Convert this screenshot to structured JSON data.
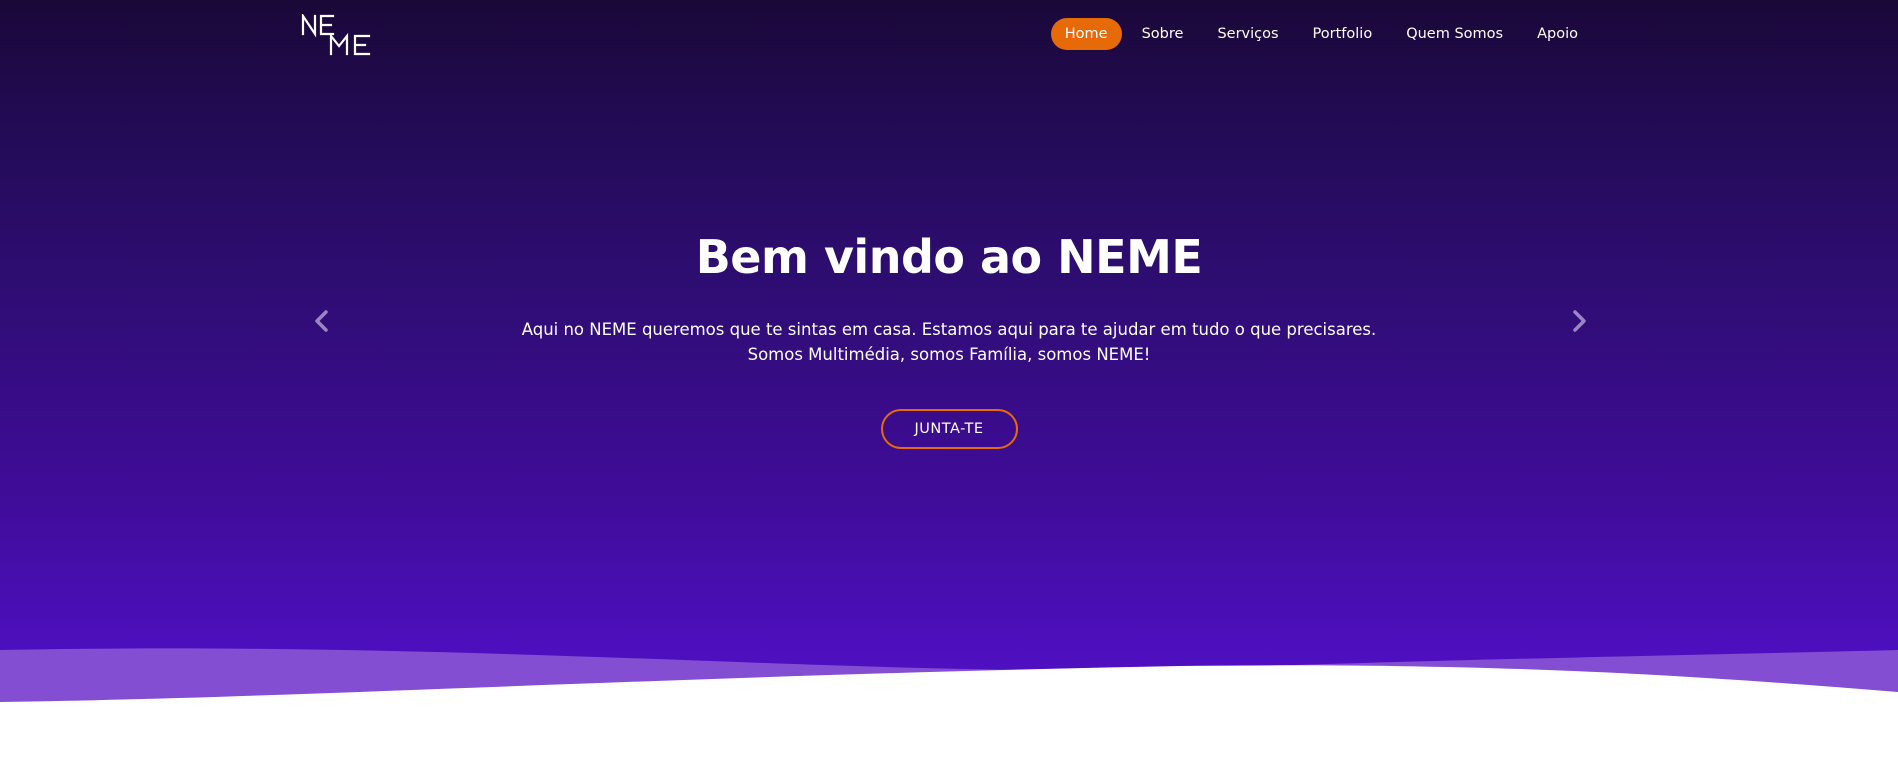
{
  "brand": {
    "logo_text": "NEME"
  },
  "nav": {
    "items": [
      {
        "label": "Home",
        "active": true
      },
      {
        "label": "Sobre",
        "active": false
      },
      {
        "label": "Serviços",
        "active": false
      },
      {
        "label": "Portfolio",
        "active": false
      },
      {
        "label": "Quem Somos",
        "active": false
      },
      {
        "label": "Apoio",
        "active": false
      }
    ]
  },
  "hero": {
    "title": "Bem vindo ao NEME",
    "subtitle_line1": "Aqui no NEME queremos que te sintas em casa. Estamos aqui para te ajudar em tudo o que precisares.",
    "subtitle_line2": "Somos Multimédia, somos Família, somos NEME!",
    "cta_label": "JUNTA-TE",
    "prev_icon": "chevron-left-icon",
    "next_icon": "chevron-right-icon"
  },
  "colors": {
    "accent": "#e66a07",
    "hero_top": "#1a0838",
    "hero_bottom": "#5211c4",
    "wave": "#8a55d4"
  }
}
